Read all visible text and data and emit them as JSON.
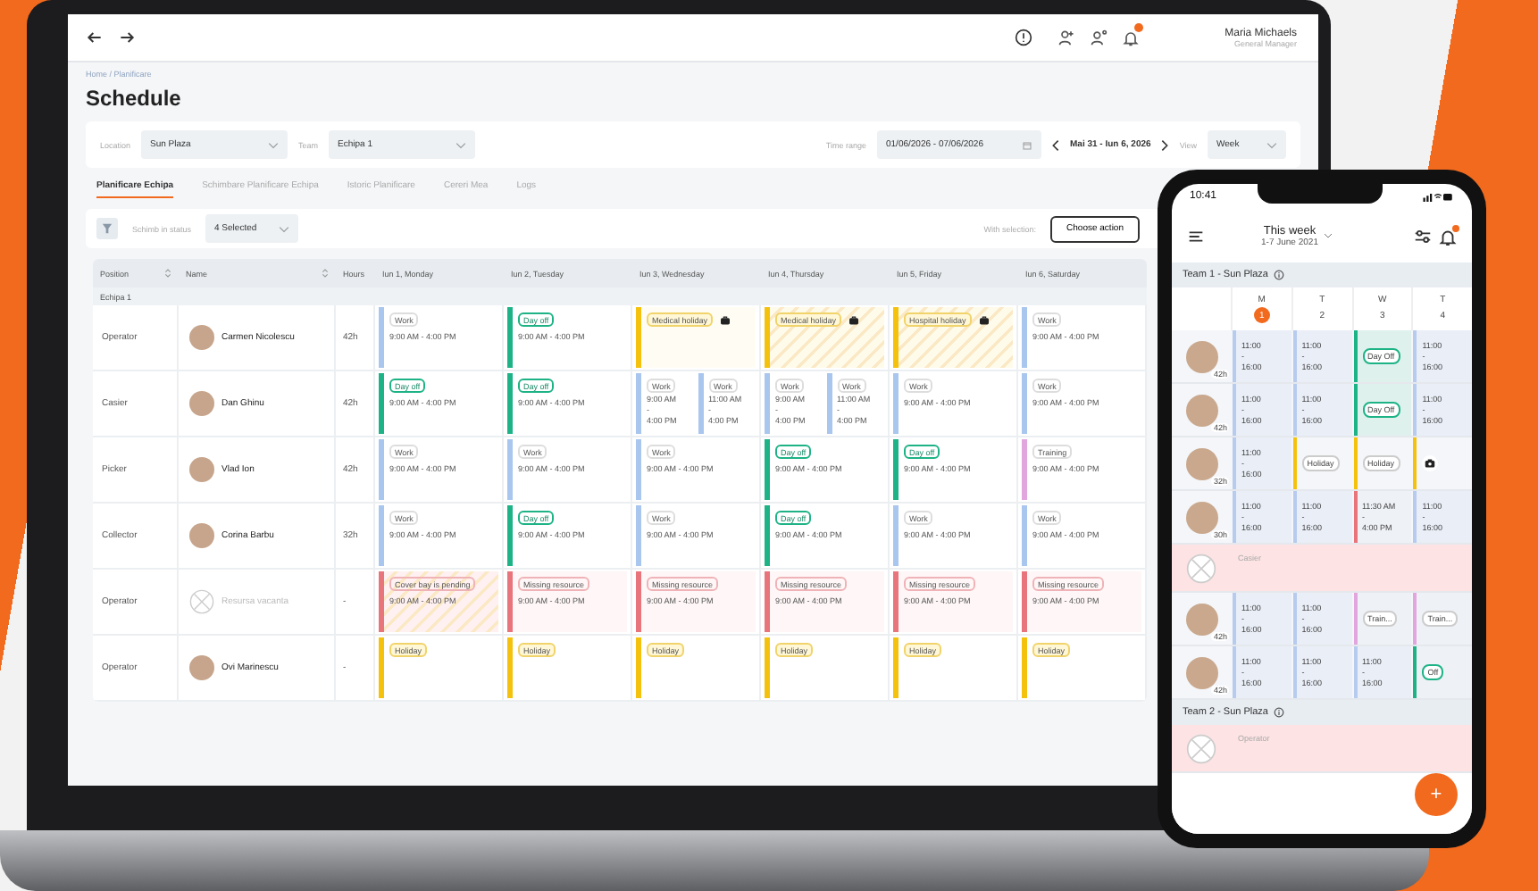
{
  "laptop": {
    "nav": {
      "user_name": "Maria Michaels",
      "user_role": "General Manager",
      "has_notifications": true
    },
    "breadcrumb": "Home / Planificare",
    "title": "Schedule",
    "filters": [
      {
        "label": "Location",
        "value": "Sun Plaza"
      },
      {
        "label": "Team",
        "value": "Echipa 1"
      }
    ],
    "time_range": {
      "label": "Time range",
      "value": "01/06/2026 - 07/06/2026"
    },
    "week_nav": "Mai 31 - Iun 6, 2026",
    "view": {
      "label": "View",
      "value": "Week"
    },
    "tabs": [
      {
        "label": "Planificare Echipa",
        "selected": true
      },
      {
        "label": "Schimbare Planificare Echipa",
        "selected": false
      },
      {
        "label": "Istoric Planificare",
        "selected": false
      },
      {
        "label": "Cereri Mea",
        "selected": false
      },
      {
        "label": "Logs",
        "selected": false
      }
    ],
    "toolbar": {
      "status_label": "Schimb in status",
      "status_value": "4 Selected",
      "action_label": "With selection:",
      "action_button": "Choose action"
    },
    "table": {
      "columns": [
        {
          "label": "Position",
          "sortable": true
        },
        {
          "label": "Name",
          "sortable": true
        },
        {
          "label": "Hours",
          "sortable": false
        },
        {
          "label": "Iun 1, Monday",
          "sortable": false
        },
        {
          "label": "Iun 2, Tuesday",
          "sortable": false
        },
        {
          "label": "Iun 3, Wednesday",
          "sortable": false
        },
        {
          "label": "Iun 4, Thursday",
          "sortable": false
        },
        {
          "label": "Iun 5, Friday",
          "sortable": false
        },
        {
          "label": "Iun 6, Saturday",
          "sortable": false
        }
      ],
      "group": "Echipa 1",
      "rows": [
        {
          "position": "Operator",
          "name": "Carmen Nicolescu",
          "kind": "person",
          "hours": "42h",
          "shifts": [
            {
              "kind": "work",
              "label": "Work",
              "time": "9:00 AM - 4:00 PM"
            },
            {
              "kind": "dayoff",
              "label": "Day off",
              "time": "9:00 AM - 4:00 PM"
            },
            {
              "kind": "medical",
              "label": "Medical holiday"
            },
            {
              "kind": "hospital",
              "label": "Medical holiday"
            },
            {
              "kind": "hospital",
              "label": "Hospital holiday"
            },
            {
              "kind": "work",
              "label": "Work",
              "time": "9:00 AM - 4:00 PM"
            }
          ]
        },
        {
          "position": "Casier",
          "name": "Dan Ghinu",
          "kind": "person",
          "hours": "42h",
          "shifts": [
            {
              "kind": "dayoff",
              "label": "Day off",
              "time": "9:00 AM - 4:00 PM"
            },
            {
              "kind": "dayoff",
              "label": "Day off",
              "time": "9:00 AM - 4:00 PM"
            },
            {
              "kind": "split",
              "parts": [
                {
                  "label": "Work",
                  "lines": [
                    "9:00 AM",
                    "-",
                    "4:00 PM"
                  ]
                },
                {
                  "label": "Work",
                  "lines": [
                    "11:00 AM",
                    "-",
                    "4:00 PM"
                  ]
                }
              ]
            },
            {
              "kind": "split",
              "parts": [
                {
                  "label": "Work",
                  "lines": [
                    "9:00 AM",
                    "-",
                    "4:00 PM"
                  ]
                },
                {
                  "label": "Work",
                  "lines": [
                    "11:00 AM",
                    "-",
                    "4:00 PM"
                  ]
                }
              ]
            },
            {
              "kind": "work",
              "label": "Work",
              "time": "9:00 AM - 4:00 PM"
            },
            {
              "kind": "work",
              "label": "Work",
              "time": "9:00 AM - 4:00 PM"
            }
          ]
        },
        {
          "position": "Picker",
          "name": "Vlad Ion",
          "kind": "person",
          "hours": "42h",
          "shifts": [
            {
              "kind": "work",
              "label": "Work",
              "time": "9:00 AM - 4:00 PM"
            },
            {
              "kind": "work",
              "label": "Work",
              "time": "9:00 AM - 4:00 PM"
            },
            {
              "kind": "work",
              "label": "Work",
              "time": "9:00 AM - 4:00 PM"
            },
            {
              "kind": "dayoff",
              "label": "Day off",
              "time": "9:00 AM - 4:00 PM"
            },
            {
              "kind": "dayoff",
              "label": "Day off",
              "time": "9:00 AM - 4:00 PM"
            },
            {
              "kind": "training",
              "label": "Training",
              "time": "9:00 AM - 4:00 PM"
            }
          ]
        },
        {
          "position": "Collector",
          "name": "Corina Barbu",
          "kind": "person",
          "hours": "32h",
          "shifts": [
            {
              "kind": "work",
              "label": "Work",
              "time": "9:00 AM - 4:00 PM"
            },
            {
              "kind": "dayoff",
              "label": "Day off",
              "time": "9:00 AM - 4:00 PM"
            },
            {
              "kind": "work",
              "label": "Work",
              "time": "9:00 AM - 4:00 PM"
            },
            {
              "kind": "dayoff",
              "label": "Day off",
              "time": "9:00 AM - 4:00 PM"
            },
            {
              "kind": "work",
              "label": "Work",
              "time": "9:00 AM - 4:00 PM"
            },
            {
              "kind": "work",
              "label": "Work",
              "time": "9:00 AM - 4:00 PM"
            }
          ]
        },
        {
          "position": "Operator",
          "name": "Resursa vacanta",
          "kind": "vacant",
          "hours": "-",
          "shifts": [
            {
              "kind": "pending",
              "label": "Cover bay is pending",
              "time": "9:00 AM - 4:00 PM"
            },
            {
              "kind": "missing",
              "label": "Missing resource",
              "time": "9:00 AM - 4:00 PM"
            },
            {
              "kind": "missing",
              "label": "Missing resource",
              "time": "9:00 AM - 4:00 PM"
            },
            {
              "kind": "missing",
              "label": "Missing resource",
              "time": "9:00 AM - 4:00 PM"
            },
            {
              "kind": "missing",
              "label": "Missing resource",
              "time": "9:00 AM - 4:00 PM"
            },
            {
              "kind": "missing",
              "label": "Missing resource",
              "time": "9:00 AM - 4:00 PM"
            }
          ]
        },
        {
          "position": "Operator",
          "name": "Ovi Marinescu",
          "kind": "person",
          "hours": "-",
          "shifts": [
            {
              "kind": "holiday",
              "label": "Holiday"
            },
            {
              "kind": "holiday",
              "label": "Holiday"
            },
            {
              "kind": "holiday",
              "label": "Holiday"
            },
            {
              "kind": "holiday",
              "label": "Holiday"
            },
            {
              "kind": "holiday",
              "label": "Holiday"
            },
            {
              "kind": "holiday",
              "label": "Holiday"
            }
          ]
        }
      ]
    }
  },
  "phone": {
    "time": "10:41",
    "week_title": "This week",
    "week_range": "1-7 June 2021",
    "has_notifications": true,
    "days": [
      {
        "letter": "M",
        "date": "1",
        "selected": true
      },
      {
        "letter": "T",
        "date": "2",
        "selected": false
      },
      {
        "letter": "W",
        "date": "3",
        "selected": false
      },
      {
        "letter": "T",
        "date": "4",
        "selected": false
      }
    ],
    "teams": [
      {
        "name": "Team 1 - Sun Plaza",
        "rows": [
          {
            "kind": "person",
            "hours": "42h",
            "cells": [
              {
                "kind": "time",
                "lines": [
                  "11:00",
                  "-",
                  "16:00"
                ]
              },
              {
                "kind": "time",
                "lines": [
                  "11:00",
                  "-",
                  "16:00"
                ]
              },
              {
                "kind": "dayoff",
                "label": "Day Off"
              },
              {
                "kind": "time",
                "lines": [
                  "11:00",
                  "-",
                  "16:00"
                ]
              }
            ]
          },
          {
            "kind": "person",
            "hours": "42h",
            "cells": [
              {
                "kind": "time",
                "lines": [
                  "11:00",
                  "-",
                  "16:00"
                ]
              },
              {
                "kind": "time",
                "lines": [
                  "11:00",
                  "-",
                  "16:00"
                ]
              },
              {
                "kind": "dayoff",
                "label": "Day Off"
              },
              {
                "kind": "time",
                "lines": [
                  "11:00",
                  "-",
                  "16:00"
                ]
              }
            ]
          },
          {
            "kind": "person",
            "hours": "32h",
            "cells": [
              {
                "kind": "time",
                "lines": [
                  "11:00",
                  "-",
                  "16:00"
                ]
              },
              {
                "kind": "holiday",
                "label": "Holiday"
              },
              {
                "kind": "holiday",
                "label": "Holiday"
              },
              {
                "kind": "camera"
              }
            ]
          },
          {
            "kind": "person",
            "hours": "30h",
            "cells": [
              {
                "kind": "time",
                "lines": [
                  "11:00",
                  "-",
                  "16:00"
                ]
              },
              {
                "kind": "time",
                "lines": [
                  "11:00",
                  "-",
                  "16:00"
                ]
              },
              {
                "kind": "missing",
                "lines": [
                  "11:30 AM",
                  "-",
                  "4:00 PM"
                ]
              },
              {
                "kind": "time",
                "lines": [
                  "11:00",
                  "-",
                  "16:00"
                ]
              }
            ]
          },
          {
            "kind": "vacant",
            "label": "Casier"
          },
          {
            "kind": "person",
            "hours": "42h",
            "cells": [
              {
                "kind": "time",
                "lines": [
                  "11:00",
                  "-",
                  "16:00"
                ]
              },
              {
                "kind": "time",
                "lines": [
                  "11:00",
                  "-",
                  "16:00"
                ]
              },
              {
                "kind": "training",
                "label": "Train..."
              },
              {
                "kind": "training",
                "label": "Train..."
              }
            ]
          },
          {
            "kind": "person",
            "hours": "42h",
            "cells": [
              {
                "kind": "time",
                "lines": [
                  "11:00",
                  "-",
                  "16:00"
                ]
              },
              {
                "kind": "time",
                "lines": [
                  "11:00",
                  "-",
                  "16:00"
                ]
              },
              {
                "kind": "time",
                "lines": [
                  "11:00",
                  "-",
                  "16:00"
                ]
              },
              {
                "kind": "off",
                "label": "Off"
              }
            ]
          }
        ]
      },
      {
        "name": "Team 2 - Sun Plaza",
        "rows": [
          {
            "kind": "vacant",
            "label": "Operator"
          }
        ]
      }
    ],
    "fab": "+"
  }
}
